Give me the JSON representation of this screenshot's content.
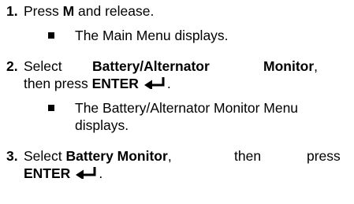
{
  "steps": [
    {
      "number": "1.",
      "pre": "Press ",
      "key": "M",
      "post": " and release.",
      "result": "The Main Menu displays."
    },
    {
      "number": "2.",
      "select_word": "Select",
      "target_a": "Battery/Alternator",
      "target_b": "Monitor",
      "comma": ",",
      "line2_pre": "then press ",
      "key": "ENTER",
      "result_line1": "The Battery/Alternator Monitor Menu",
      "result_line2": "displays.",
      "icon": "enter-key-icon"
    },
    {
      "number": "3.",
      "line1_pre": "Select ",
      "target": "Battery Monitor",
      "line1_mid": ",",
      "then_word": "then",
      "press_word": "press",
      "key": "ENTER",
      "icon": "enter-key-icon"
    }
  ],
  "colors": {
    "text": "#000000",
    "background": "#ffffff"
  }
}
